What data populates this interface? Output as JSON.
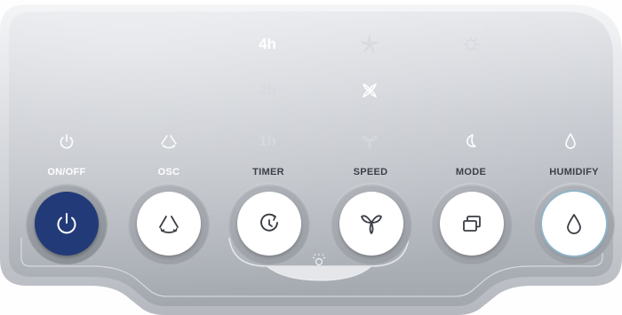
{
  "colors": {
    "panel_top": "#e6e8ec",
    "panel_bottom": "#9ea3aa",
    "indicator_on": "#ffffff",
    "indicator_dim": "#d8dbe0",
    "label": "#ffffff",
    "power_button": "#243a78",
    "button_face": "#ffffff",
    "button_icon": "#3a3d44",
    "humidify_ring": "#8fb4c8"
  },
  "indicators": {
    "timer": {
      "hour_4": "4h",
      "hour_2": "2h",
      "hour_1": "1h"
    },
    "speed": {
      "high_icon": "fan-star-icon",
      "medium_icon": "fan-x-icon",
      "low_icon": "fan-y-icon"
    },
    "mode": {
      "top_icon": "sun-gear-icon",
      "middle_icon": "leaf-icon",
      "bottom_icon": "moon-icon"
    },
    "power_icon": "power-icon",
    "osc_icon": "oscillate-icon",
    "humidify_icon": "droplet-icon"
  },
  "buttons": [
    {
      "id": "onoff",
      "label": "ON/OFF",
      "icon": "power-icon"
    },
    {
      "id": "osc",
      "label": "OSC",
      "icon": "oscillate-icon"
    },
    {
      "id": "timer",
      "label": "TIMER",
      "icon": "timer-icon"
    },
    {
      "id": "speed",
      "label": "SPEED",
      "icon": "fan-icon"
    },
    {
      "id": "mode",
      "label": "MODE",
      "icon": "layers-icon"
    },
    {
      "id": "humidify",
      "label": "HUMIDIFY",
      "icon": "droplet-icon"
    }
  ],
  "light": {
    "icon": "light-bulb-icon"
  }
}
